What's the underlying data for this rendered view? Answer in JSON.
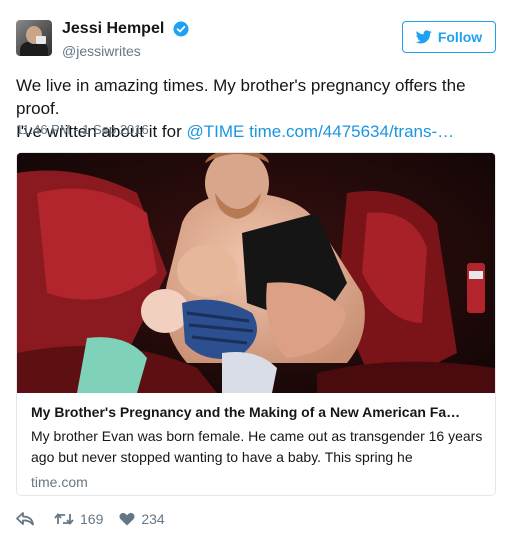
{
  "header": {
    "display_name": "Jessi Hempel",
    "handle": "@jessiwrites",
    "follow_label": "Follow"
  },
  "tweet": {
    "text_line1": "We live in amazing times. My brother's pregnancy offers the proof.",
    "text_line2_prefix": "I've written about it for ",
    "mention": "@TIME",
    "url": "time.com/4475634/trans-…",
    "timestamp": "11:46 PM - 1 Sep 2016"
  },
  "card": {
    "title": "My Brother's Pregnancy and the Making of a New American Fa…",
    "description": "My brother Evan was born female. He came out as transgender 16 years ago but never stopped wanting to have a baby. This spring he",
    "domain": "time.com"
  },
  "actions": {
    "retweets": "169",
    "likes": "234"
  },
  "colors": {
    "accent": "#1da1f2",
    "link": "#1b95e0",
    "muted": "#657786",
    "text": "#14171a",
    "like": "#657786"
  },
  "icons": [
    "verified-badge-icon",
    "twitter-bird-icon",
    "reply-icon",
    "retweet-icon",
    "heart-icon"
  ]
}
